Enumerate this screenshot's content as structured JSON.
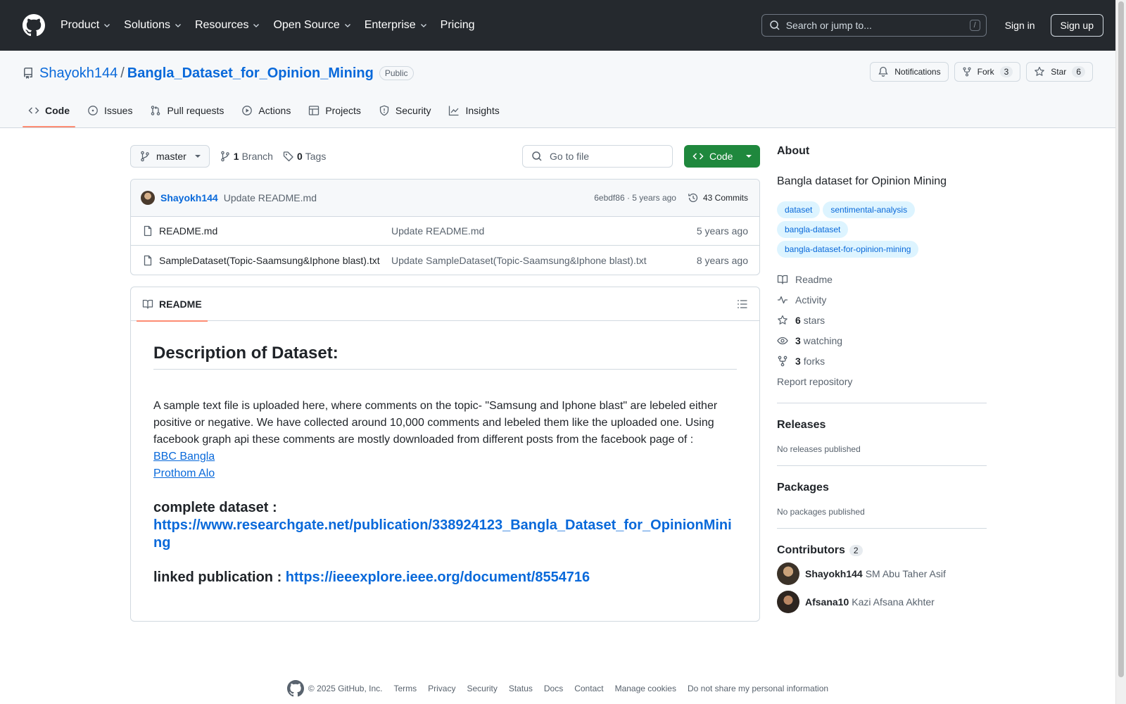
{
  "header": {
    "nav": [
      {
        "label": "Product",
        "dropdown": true
      },
      {
        "label": "Solutions",
        "dropdown": true
      },
      {
        "label": "Resources",
        "dropdown": true
      },
      {
        "label": "Open Source",
        "dropdown": true
      },
      {
        "label": "Enterprise",
        "dropdown": true
      },
      {
        "label": "Pricing",
        "dropdown": false
      }
    ],
    "search_placeholder": "Search or jump to...",
    "search_shortcut": "/",
    "sign_in": "Sign in",
    "sign_up": "Sign up"
  },
  "repo": {
    "owner": "Shayokh144",
    "separator": "/",
    "name": "Bangla_Dataset_for_Opinion_Mining",
    "visibility": "Public",
    "notifications_label": "Notifications",
    "fork_label": "Fork",
    "fork_count": "3",
    "star_label": "Star",
    "star_count": "6",
    "tabs": [
      {
        "label": "Code",
        "icon": "code-icon"
      },
      {
        "label": "Issues",
        "icon": "issue-icon"
      },
      {
        "label": "Pull requests",
        "icon": "pull-request-icon"
      },
      {
        "label": "Actions",
        "icon": "play-icon"
      },
      {
        "label": "Projects",
        "icon": "table-icon"
      },
      {
        "label": "Security",
        "icon": "shield-icon"
      },
      {
        "label": "Insights",
        "icon": "graph-icon"
      }
    ]
  },
  "toolbar": {
    "branch": "master",
    "branch_count": "1",
    "branch_label": "Branch",
    "tag_count": "0",
    "tag_label": "Tags",
    "goto_placeholder": "Go to file",
    "code_button": "Code"
  },
  "latest_commit": {
    "author": "Shayokh144",
    "message": "Update README.md",
    "hash_time": "6ebdf86 · 5 years ago",
    "commits_count": "43 Commits"
  },
  "files": [
    {
      "name": "README.md",
      "message": "Update README.md",
      "date": "5 years ago"
    },
    {
      "name": "SampleDataset(Topic-Saamsung&Iphone blast).txt",
      "message": "Update SampleDataset(Topic-Saamsung&Iphone blast).txt",
      "date": "8 years ago"
    }
  ],
  "readme": {
    "tab_label": "README",
    "title": "Description of Dataset:",
    "paragraph": "A sample text file is uploaded here, where comments on the topic- \"Samsung and Iphone blast\" are lebeled either positive or negative. We have collected around 10,000 comments and lebeled them like the uploaded one. Using facebook graph api these comments are mostly downloaded from different posts from the facebook page of :",
    "link1": "BBC Bangla",
    "link2": "Prothom Alo",
    "complete_label": "complete dataset :",
    "complete_url": "https://www.researchgate.net/publication/338924123_Bangla_Dataset_for_OpinionMining",
    "linked_label": "linked publication :",
    "linked_url": "https://ieeexplore.ieee.org/document/8554716"
  },
  "about": {
    "heading": "About",
    "description": "Bangla dataset for Opinion Mining",
    "topics": [
      "dataset",
      "sentimental-analysis",
      "bangla-dataset",
      "bangla-dataset-for-opinion-mining"
    ],
    "readme": "Readme",
    "activity": "Activity",
    "stars_count": "6",
    "stars_label": "stars",
    "watching_count": "3",
    "watching_label": "watching",
    "forks_count": "3",
    "forks_label": "forks",
    "report": "Report repository"
  },
  "releases": {
    "heading": "Releases",
    "sub": "No releases published"
  },
  "packages": {
    "heading": "Packages",
    "sub": "No packages published"
  },
  "contributors": {
    "heading": "Contributors",
    "count": "2",
    "list": [
      {
        "login": "Shayokh144",
        "name": "SM Abu Taher Asif"
      },
      {
        "login": "Afsana10",
        "name": "Kazi Afsana Akhter"
      }
    ]
  },
  "footer": {
    "copyright": "© 2025 GitHub, Inc.",
    "links": [
      "Terms",
      "Privacy",
      "Security",
      "Status",
      "Docs",
      "Contact",
      "Manage cookies",
      "Do not share my personal information"
    ]
  },
  "colors": {
    "header_bg": "#25292e",
    "link": "#0969da",
    "primary_button": "#1f883d",
    "tab_underline": "#fd8c73",
    "topic_bg": "#ddf4ff"
  }
}
